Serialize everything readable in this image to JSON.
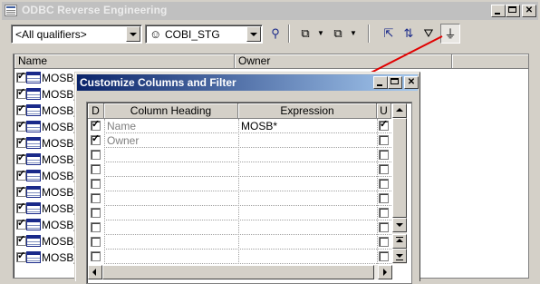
{
  "window": {
    "title": "ODBC Reverse Engineering"
  },
  "toolbar": {
    "qualifier_value": "<All qualifiers>",
    "owner_value": "COBI_STG",
    "icons": [
      "owner-icon",
      "find-icon",
      "select-all-icon",
      "deselect-all-icon",
      "set-root-icon",
      "mark-icon",
      "filter-icon",
      "customize-columns-icon"
    ]
  },
  "list": {
    "columns": [
      "Name",
      "Owner"
    ],
    "rows": [
      "MOSB_",
      "MOSB_",
      "MOSB_",
      "MOSB_",
      "MOSB_",
      "MOSB_",
      "MOSB_",
      "MOSB_",
      "MOSB_",
      "MOSB_",
      "MOSB_",
      "MOSB_"
    ]
  },
  "dialog": {
    "title": "Customize Columns and Filter",
    "columns": {
      "d": "D",
      "heading": "Column Heading",
      "expression": "Expression",
      "u": "U"
    },
    "rows": [
      {
        "d": true,
        "heading": "Name",
        "expression": "MOSB*",
        "u": true
      },
      {
        "d": true,
        "heading": "Owner",
        "expression": "",
        "u": false
      },
      {
        "d": false,
        "heading": "",
        "expression": "",
        "u": false
      },
      {
        "d": false,
        "heading": "",
        "expression": "",
        "u": false
      },
      {
        "d": false,
        "heading": "",
        "expression": "",
        "u": false
      },
      {
        "d": false,
        "heading": "",
        "expression": "",
        "u": false
      },
      {
        "d": false,
        "heading": "",
        "expression": "",
        "u": false
      },
      {
        "d": false,
        "heading": "",
        "expression": "",
        "u": false
      },
      {
        "d": false,
        "heading": "",
        "expression": "",
        "u": false
      },
      {
        "d": false,
        "heading": "",
        "expression": "",
        "u": false
      }
    ]
  },
  "annotation": {
    "arrow_color": "#e00000"
  }
}
